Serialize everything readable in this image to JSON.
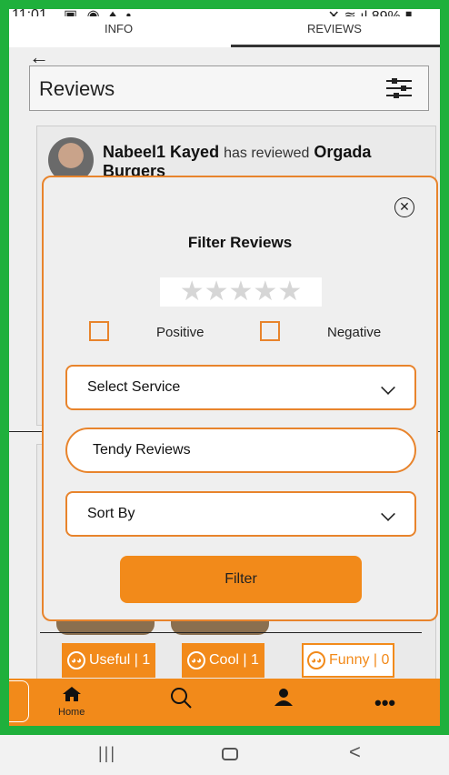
{
  "status_bar": {
    "time": "11:01",
    "battery": "89%"
  },
  "tabs": [
    {
      "label": "INFO"
    },
    {
      "label": "REVIEWS"
    }
  ],
  "header": {
    "title": "Reviews"
  },
  "review": {
    "reviewer": "Nabeel1 Kayed",
    "action": "has reviewed",
    "business": "Orgada Burgers"
  },
  "reactions": [
    {
      "label": "Useful | 1"
    },
    {
      "label": "Cool | 1"
    },
    {
      "label": "Funny | 0"
    }
  ],
  "bottom_nav": {
    "home_label": "Home"
  },
  "filter_modal": {
    "title": "Filter Reviews",
    "rating_stars": "★★★★★",
    "positive_label": "Positive",
    "negative_label": "Negative",
    "service_select": "Select Service",
    "trendy_label": "Tendy Reviews",
    "sort_select": "Sort By",
    "filter_button": "Filter"
  },
  "colors": {
    "accent": "#f28a1a",
    "frame": "#1fb03c"
  }
}
